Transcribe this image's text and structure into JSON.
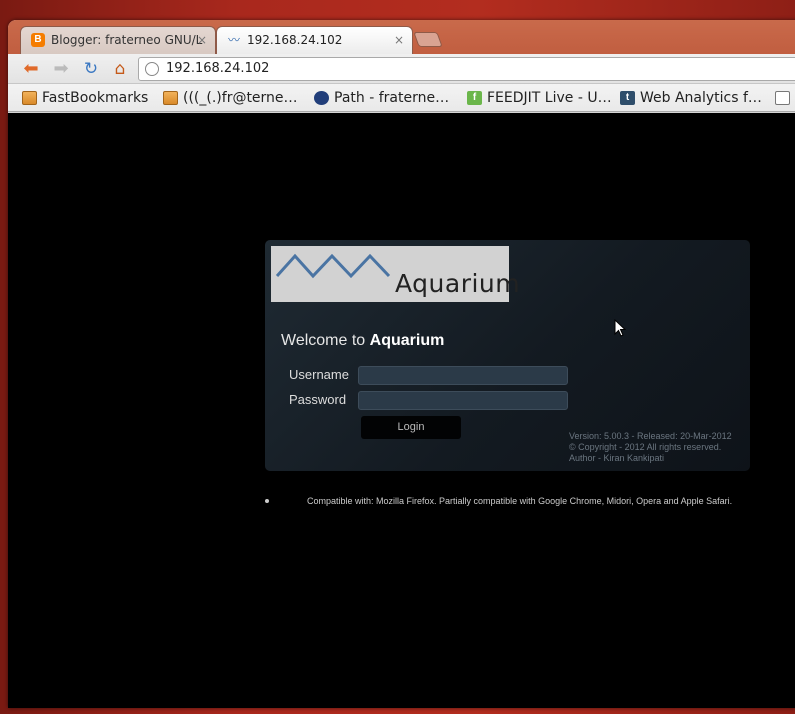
{
  "tabs": [
    {
      "title": "Blogger: fraterneo GNU/L",
      "close": "×"
    },
    {
      "title": "192.168.24.102",
      "close": "×"
    }
  ],
  "toolbar": {
    "url": "192.168.24.102"
  },
  "bookmarks": [
    {
      "label": "FastBookmarks",
      "icon": "folder-icon"
    },
    {
      "label": "(((_(.)fr@terne…",
      "icon": "folder-icon"
    },
    {
      "label": "Path - fraterne…",
      "icon": "path-icon"
    },
    {
      "label": "FEEDJIT Live - U…",
      "icon": "feedjit-icon"
    },
    {
      "label": "Web Analytics f…",
      "icon": "tumblr-icon"
    }
  ],
  "login": {
    "logo_text": "Aquarium",
    "welcome_prefix": "Welcome to",
    "welcome_app": "Aquarium",
    "username_label": "Username",
    "password_label": "Password",
    "username_value": "",
    "password_value": "",
    "login_button": "Login",
    "version": "Version: 5.00.3 - Released: 20-Mar-2012",
    "copyright": "© Copyright - 2012 All rights reserved.",
    "author": "Author - Kiran Kankipati",
    "compat": "Compatible with: Mozilla Firefox. Partially compatible with Google Chrome, Midori, Opera and Apple Safari."
  },
  "colors": {
    "tabstrip": "#c15e40",
    "page_background": "#000000",
    "panel": "#1a232c",
    "logo_wave": "#4a74a3"
  }
}
